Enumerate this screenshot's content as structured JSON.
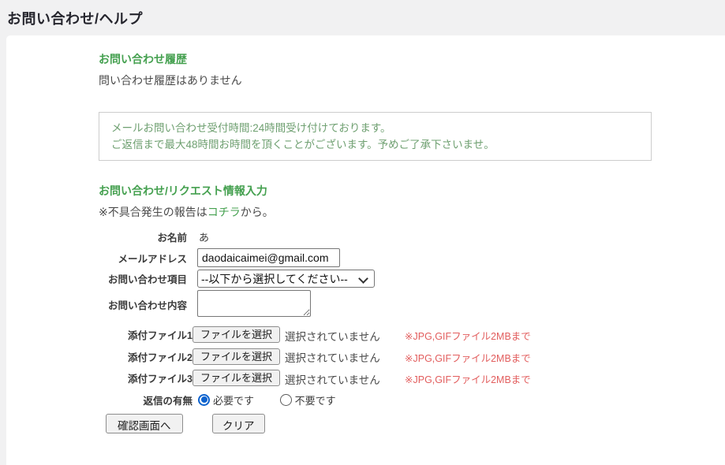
{
  "page": {
    "title": "お問い合わせ/ヘルプ"
  },
  "history": {
    "heading": "お問い合わせ履歴",
    "empty_message": "問い合わせ履歴はありません"
  },
  "notice": {
    "line1": "メールお問い合わせ受付時間:24時間受け付けております。",
    "line2": "ご返信まで最大48時間お時間を頂くことがございます。予めご了承下さいませ。"
  },
  "form": {
    "heading": "お問い合わせ/リクエスト情報入力",
    "bug_report_prefix": "※不具合発生の報告は",
    "bug_report_link": "コチラ",
    "bug_report_suffix": "から。",
    "name": {
      "label": "お名前",
      "value": "あ"
    },
    "email": {
      "label": "メールアドレス",
      "value": "daodaicaimei@gmail.com"
    },
    "category": {
      "label": "お問い合わせ項目",
      "selected": "--以下から選択してください--"
    },
    "message": {
      "label": "お問い合わせ内容",
      "value": ""
    },
    "attachments": [
      {
        "label": "添付ファイル1",
        "button": "ファイルを選択",
        "status": "選択されていません",
        "note": "※JPG,GIFファイル2MBまで"
      },
      {
        "label": "添付ファイル2",
        "button": "ファイルを選択",
        "status": "選択されていません",
        "note": "※JPG,GIFファイル2MBまで"
      },
      {
        "label": "添付ファイル3",
        "button": "ファイルを選択",
        "status": "選択されていません",
        "note": "※JPG,GIFファイル2MBまで"
      }
    ],
    "reply": {
      "label": "返信の有無",
      "options": [
        {
          "label": "必要です",
          "selected": true
        },
        {
          "label": "不要です",
          "selected": false
        }
      ]
    },
    "buttons": {
      "confirm": "確認画面へ",
      "clear": "クリア"
    }
  },
  "colors": {
    "accent_green": "#44a04f",
    "notice_green": "#6fa071",
    "warning_red": "#e25d5d",
    "radio_blue": "#0e63ce",
    "page_background": "#f1f1f2",
    "card_background": "#ffffff"
  }
}
